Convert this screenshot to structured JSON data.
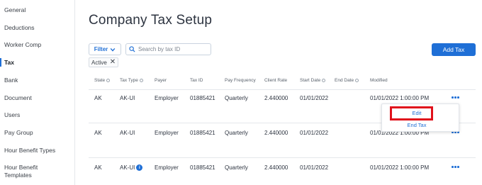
{
  "sidebar": {
    "items": [
      {
        "label": "General"
      },
      {
        "label": "Deductions"
      },
      {
        "label": "Worker Comp"
      },
      {
        "label": "Tax"
      },
      {
        "label": "Bank"
      },
      {
        "label": "Document"
      },
      {
        "label": "Users"
      },
      {
        "label": "Pay Group"
      },
      {
        "label": "Hour Benefit Types"
      },
      {
        "label": "Hour Benefit Templates"
      }
    ],
    "active": "Tax"
  },
  "page": {
    "title": "Company Tax Setup"
  },
  "toolbar": {
    "filter_label": "Filter",
    "search_placeholder": "Search by tax ID",
    "active_chip": "Active",
    "add_tax_label": "Add Tax"
  },
  "table": {
    "columns": [
      "State",
      "Tax Type",
      "Payer",
      "Tax ID",
      "Pay Frequency",
      "Client Rate",
      "Start Date",
      "End Date",
      "Modified"
    ],
    "rows": [
      {
        "state": "AK",
        "tax_type": "AK-UI",
        "payer": "Employer",
        "tax_id": "01885421",
        "pay_frequency": "Quarterly",
        "client_rate": "2.440000",
        "start_date": "01/01/2022",
        "end_date": "",
        "modified": "01/01/2022 1:00:00 PM",
        "info": false
      },
      {
        "state": "AK",
        "tax_type": "AK-UI",
        "payer": "Employer",
        "tax_id": "01885421",
        "pay_frequency": "Quarterly",
        "client_rate": "2.440000",
        "start_date": "01/01/2022",
        "end_date": "",
        "modified": "01/01/2022 1:00:00 PM",
        "info": false
      },
      {
        "state": "AK",
        "tax_type": "AK-UI",
        "payer": "Employer",
        "tax_id": "01885421",
        "pay_frequency": "Quarterly",
        "client_rate": "2.440000",
        "start_date": "01/01/2022",
        "end_date": "",
        "modified": "01/01/2022 1:00:00 PM",
        "info": true
      }
    ]
  },
  "row_menu": {
    "items": [
      "Edit",
      "End Tax"
    ],
    "highlighted": "Edit"
  },
  "colors": {
    "accent": "#1f6fd6",
    "highlight": "#e0111b"
  }
}
